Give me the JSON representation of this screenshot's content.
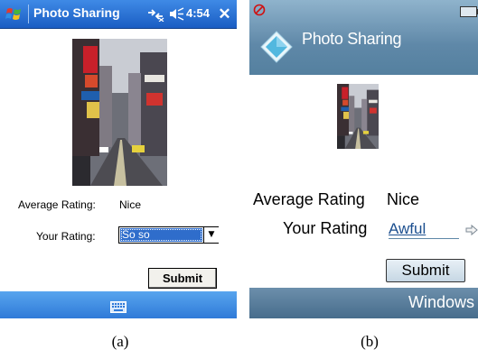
{
  "panel_a": {
    "title": "Photo Sharing",
    "time": "4:54",
    "close_label": "✕",
    "average_rating_label": "Average Rating:",
    "average_rating_value": "Nice",
    "your_rating_label": "Your Rating:",
    "your_rating_value": "So so",
    "submit_label": "Submit",
    "colors": {
      "titlebar": "#1a5dc3",
      "selection": "#2f6dcb",
      "bottombar": "#2f7ad8"
    }
  },
  "panel_b": {
    "title": "Photo Sharing",
    "average_rating_label": "Average Rating",
    "average_rating_value": "Nice",
    "your_rating_label": "Your Rating",
    "your_rating_value": "Awful",
    "submit_label": "Submit",
    "softkey_label": "Windows",
    "colors": {
      "header": "#5f88a8",
      "softkey_bar": "#476d8c",
      "link": "#1c4f8f"
    }
  },
  "captions": {
    "a": "(a)",
    "b": "(b)"
  },
  "icons": {
    "a_start": "windows-flag-icon",
    "a_connectivity": "connectivity-icon",
    "a_volume": "volume-icon",
    "a_keyboard": "keyboard-icon",
    "b_status": "no-signal-icon",
    "b_battery": "battery-icon",
    "b_app": "diamond-app-icon",
    "b_scroll": "hand-pointer-icon"
  }
}
